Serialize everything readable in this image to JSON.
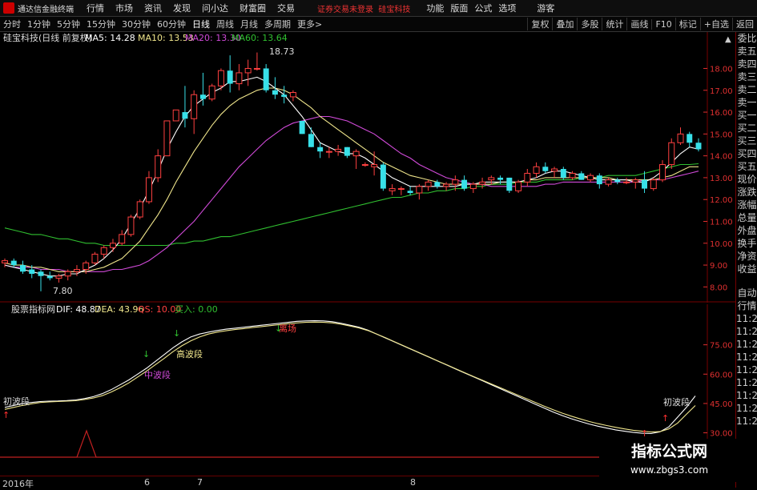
{
  "menubar": {
    "title": "通达信金融终端",
    "menus": [
      "行情",
      "市场",
      "资讯",
      "发现",
      "问小达",
      "财富圈",
      "交易"
    ],
    "notice": "证券交易未登录",
    "notice_stock": "硅宝科技",
    "right_menus": [
      "功能",
      "版面",
      "公式",
      "选项"
    ],
    "guest": "游客"
  },
  "periodbar": {
    "periods": [
      "分时",
      "1分钟",
      "5分钟",
      "15分钟",
      "30分钟",
      "60分钟",
      "日线",
      "周线",
      "月线",
      "多周期",
      "更多>"
    ],
    "active": "日线",
    "tools": [
      "复权",
      "叠加",
      "多股",
      "统计",
      "画线",
      "F10",
      "标记",
      "+自选",
      "返回"
    ]
  },
  "main_header": {
    "stock": "硅宝科技(日线 前复权)",
    "ma5": "MA5: 14.28",
    "ma10": "MA10: 13.53",
    "ma20": "MA20: 13.30",
    "ma60": "MA60: 13.64"
  },
  "ind_header": {
    "name": "股票指标网",
    "dif": "DIF: 48.87",
    "dea": "DEA: 43.96",
    "qs": "QS: 10.00",
    "buy": "买入: 0.00"
  },
  "annotations": {
    "high": "18.73",
    "low": "7.80",
    "initial_wave_left": "初波段",
    "mid_wave": "中波段",
    "high_wave": "高波段",
    "exit": "离场",
    "initial_wave_right": "初波段"
  },
  "time_axis": {
    "labels": [
      "2016年",
      "6",
      "7",
      "8"
    ]
  },
  "sidepanel": {
    "items": [
      "委比",
      "卖五",
      "卖四",
      "卖三",
      "卖二",
      "卖一",
      "买一",
      "买二",
      "买三",
      "买四",
      "买五",
      "现价",
      "涨跌",
      "涨幅",
      "总量",
      "外盘",
      "换手",
      "净资",
      "收益",
      "自动",
      "行情",
      "11:2",
      "11:2",
      "11:2",
      "11:2",
      "11:2",
      "11:2",
      "11:2",
      "11:2",
      "11:2"
    ]
  },
  "watermark": {
    "title": "指标公式网",
    "url": "www.zbgs3.com"
  },
  "colors": {
    "up": "#ff4040",
    "down": "#38e0e8",
    "ma5": "#ffffff",
    "ma10": "#f0e68c",
    "ma20": "#d04ad8",
    "ma60": "#30c030",
    "axis": "#e03030"
  },
  "chart_data": [
    {
      "type": "candlestick",
      "title": "硅宝科技(日线 前复权)",
      "ylim": [
        7.5,
        19.3
      ],
      "yticks": [
        8.0,
        9.0,
        10.0,
        11.0,
        12.0,
        13.0,
        14.0,
        15.0,
        16.0,
        17.0,
        18.0
      ],
      "candles": [
        [
          9.1,
          9.3,
          8.9,
          9.2
        ],
        [
          9.2,
          9.3,
          8.9,
          9.0
        ],
        [
          9.0,
          9.2,
          8.6,
          8.7
        ],
        [
          8.8,
          9.0,
          8.4,
          8.6
        ],
        [
          8.7,
          8.8,
          7.8,
          8.5
        ],
        [
          8.5,
          8.7,
          8.3,
          8.4
        ],
        [
          8.4,
          8.6,
          8.2,
          8.5
        ],
        [
          8.5,
          8.8,
          8.3,
          8.7
        ],
        [
          8.7,
          9.0,
          8.5,
          8.8
        ],
        [
          8.8,
          9.2,
          8.6,
          9.1
        ],
        [
          9.1,
          9.6,
          9.0,
          9.5
        ],
        [
          9.5,
          9.9,
          9.3,
          9.8
        ],
        [
          9.8,
          10.2,
          9.6,
          10.0
        ],
        [
          10.0,
          10.6,
          9.9,
          10.4
        ],
        [
          10.4,
          11.3,
          10.3,
          11.2
        ],
        [
          11.2,
          12.0,
          11.1,
          11.9
        ],
        [
          11.9,
          13.3,
          11.8,
          13.0
        ],
        [
          13.0,
          14.3,
          12.8,
          14.0
        ],
        [
          14.0,
          15.6,
          14.0,
          15.6
        ],
        [
          15.6,
          16.1,
          15.6,
          16.1
        ],
        [
          16.0,
          17.2,
          15.3,
          15.7
        ],
        [
          15.7,
          17.0,
          15.0,
          16.8
        ],
        [
          16.8,
          17.8,
          16.3,
          16.6
        ],
        [
          16.6,
          17.3,
          16.5,
          17.2
        ],
        [
          17.2,
          18.0,
          17.0,
          17.9
        ],
        [
          17.9,
          18.6,
          16.9,
          17.3
        ],
        [
          17.3,
          18.2,
          17.0,
          17.8
        ],
        [
          17.8,
          18.4,
          17.2,
          18.0
        ],
        [
          18.0,
          18.73,
          17.9,
          18.0
        ],
        [
          18.0,
          18.2,
          16.9,
          17.0
        ],
        [
          17.0,
          17.6,
          16.6,
          16.8
        ],
        [
          16.8,
          17.2,
          16.4,
          16.7
        ],
        [
          16.7,
          17.0,
          16.5,
          16.9
        ],
        [
          15.6,
          15.6,
          15.0,
          15.0
        ],
        [
          15.0,
          15.3,
          14.4,
          14.4
        ],
        [
          14.4,
          14.6,
          13.9,
          14.2
        ],
        [
          14.2,
          14.4,
          13.9,
          14.2
        ],
        [
          14.2,
          14.5,
          14.0,
          14.3
        ],
        [
          14.4,
          14.4,
          13.9,
          14.0
        ],
        [
          14.0,
          14.3,
          13.4,
          14.2
        ],
        [
          13.6,
          13.7,
          13.5,
          13.6
        ],
        [
          13.5,
          14.2,
          13.1,
          13.6
        ],
        [
          13.6,
          13.7,
          12.4,
          12.5
        ],
        [
          12.4,
          12.7,
          12.2,
          12.5
        ],
        [
          12.5,
          12.6,
          12.2,
          12.5
        ],
        [
          12.4,
          12.6,
          12.2,
          12.3
        ],
        [
          12.3,
          12.7,
          12.0,
          12.6
        ],
        [
          12.6,
          12.9,
          12.4,
          12.8
        ],
        [
          12.8,
          12.9,
          12.5,
          12.6
        ],
        [
          12.6,
          12.8,
          12.4,
          12.7
        ],
        [
          12.7,
          13.1,
          12.4,
          12.9
        ],
        [
          12.9,
          13.1,
          12.4,
          12.5
        ],
        [
          12.5,
          12.8,
          12.3,
          12.7
        ],
        [
          12.7,
          13.0,
          12.5,
          12.8
        ],
        [
          12.9,
          13.1,
          12.7,
          13.0
        ],
        [
          13.0,
          13.1,
          12.7,
          12.9
        ],
        [
          13.0,
          13.0,
          12.3,
          12.4
        ],
        [
          12.4,
          12.9,
          12.3,
          12.8
        ],
        [
          12.8,
          13.4,
          12.6,
          13.2
        ],
        [
          13.2,
          13.7,
          13.0,
          13.5
        ],
        [
          13.5,
          13.7,
          13.2,
          13.3
        ],
        [
          13.3,
          13.5,
          13.0,
          13.4
        ],
        [
          13.4,
          13.5,
          12.9,
          13.0
        ],
        [
          13.0,
          13.3,
          12.9,
          13.2
        ],
        [
          13.2,
          13.3,
          12.9,
          12.9
        ],
        [
          12.9,
          13.2,
          12.8,
          13.1
        ],
        [
          13.1,
          13.2,
          12.5,
          12.7
        ],
        [
          12.7,
          13.0,
          12.6,
          12.9
        ],
        [
          12.9,
          13.0,
          12.7,
          12.8
        ],
        [
          12.8,
          13.0,
          12.7,
          12.8
        ],
        [
          12.8,
          13.0,
          12.5,
          12.9
        ],
        [
          12.9,
          13.3,
          12.3,
          12.5
        ],
        [
          12.5,
          13.0,
          12.4,
          12.9
        ],
        [
          12.9,
          13.8,
          12.8,
          13.6
        ],
        [
          13.6,
          14.8,
          13.4,
          14.6
        ],
        [
          14.6,
          15.3,
          14.5,
          15.0
        ],
        [
          15.0,
          15.1,
          14.4,
          14.6
        ],
        [
          14.6,
          14.8,
          14.2,
          14.3
        ]
      ],
      "ma5": [
        9.0,
        8.9,
        8.8,
        8.7,
        8.6,
        8.5,
        8.5,
        8.6,
        8.6,
        8.8,
        9.0,
        9.3,
        9.7,
        10.2,
        10.9,
        11.6,
        12.4,
        13.3,
        14.3,
        15.1,
        15.8,
        16.3,
        16.6,
        16.9,
        17.1,
        17.4,
        17.4,
        17.5,
        17.6,
        17.4,
        17.1,
        16.8,
        16.3,
        15.8,
        15.2,
        14.6,
        14.4,
        14.2,
        14.1,
        14.1,
        13.9,
        13.6,
        13.3,
        13.0,
        12.8,
        12.6,
        12.6,
        12.6,
        12.6,
        12.6,
        12.6,
        12.7,
        12.7,
        12.8,
        12.8,
        12.8,
        12.8,
        12.8,
        12.9,
        13.0,
        13.2,
        13.3,
        13.3,
        13.2,
        13.1,
        13.0,
        12.9,
        12.9,
        12.9,
        12.9,
        12.8,
        12.8,
        13.0,
        13.3,
        13.7,
        14.1,
        14.4,
        14.3
      ],
      "ma10": [
        9.1,
        9.0,
        9.0,
        8.9,
        8.9,
        8.8,
        8.7,
        8.7,
        8.7,
        8.7,
        8.8,
        8.9,
        9.1,
        9.3,
        9.7,
        10.1,
        10.7,
        11.3,
        12.0,
        12.8,
        13.5,
        14.2,
        14.8,
        15.4,
        15.9,
        16.3,
        16.6,
        16.8,
        17.0,
        17.1,
        17.1,
        17.0,
        16.8,
        16.5,
        16.2,
        15.8,
        15.5,
        15.2,
        14.9,
        14.6,
        14.3,
        14.0,
        13.7,
        13.5,
        13.3,
        13.1,
        13.0,
        12.9,
        12.8,
        12.7,
        12.7,
        12.7,
        12.7,
        12.7,
        12.7,
        12.8,
        12.8,
        12.8,
        12.9,
        12.9,
        13.0,
        13.0,
        13.0,
        13.0,
        13.0,
        13.0,
        13.0,
        13.0,
        12.9,
        12.9,
        12.9,
        12.9,
        12.9,
        13.0,
        13.1,
        13.3,
        13.5,
        13.5
      ],
      "ma20": [
        9.0,
        8.9,
        8.9,
        8.9,
        8.8,
        8.8,
        8.8,
        8.7,
        8.7,
        8.7,
        8.7,
        8.7,
        8.8,
        8.8,
        8.9,
        9.0,
        9.2,
        9.5,
        9.8,
        10.2,
        10.6,
        11.0,
        11.5,
        12.0,
        12.5,
        13.0,
        13.5,
        13.9,
        14.3,
        14.7,
        15.0,
        15.3,
        15.5,
        15.6,
        15.7,
        15.8,
        15.8,
        15.7,
        15.6,
        15.4,
        15.2,
        15.0,
        14.7,
        14.4,
        14.1,
        13.9,
        13.6,
        13.4,
        13.2,
        13.0,
        12.9,
        12.8,
        12.7,
        12.7,
        12.6,
        12.6,
        12.6,
        12.6,
        12.6,
        12.6,
        12.7,
        12.7,
        12.8,
        12.8,
        12.8,
        12.8,
        12.8,
        12.8,
        12.8,
        12.8,
        12.8,
        12.9,
        12.9,
        12.9,
        13.0,
        13.1,
        13.2,
        13.3
      ],
      "ma60": [
        10.7,
        10.6,
        10.5,
        10.4,
        10.4,
        10.3,
        10.2,
        10.2,
        10.1,
        10.0,
        10.0,
        9.9,
        9.9,
        9.9,
        9.9,
        9.9,
        9.9,
        9.9,
        9.9,
        10.0,
        10.0,
        10.1,
        10.1,
        10.2,
        10.3,
        10.3,
        10.4,
        10.5,
        10.6,
        10.7,
        10.8,
        10.9,
        11.0,
        11.1,
        11.2,
        11.3,
        11.4,
        11.5,
        11.6,
        11.7,
        11.8,
        11.9,
        12.0,
        12.1,
        12.1,
        12.2,
        12.3,
        12.3,
        12.4,
        12.4,
        12.5,
        12.5,
        12.6,
        12.6,
        12.7,
        12.7,
        12.7,
        12.8,
        12.8,
        12.8,
        12.9,
        12.9,
        12.9,
        12.9,
        13.0,
        13.0,
        13.0,
        13.1,
        13.1,
        13.1,
        13.1,
        13.2,
        13.3,
        13.4,
        13.5,
        13.6,
        13.6,
        13.64
      ]
    },
    {
      "type": "line",
      "title": "股票指标网",
      "ylim": [
        20,
        90
      ],
      "yticks": [
        30.0,
        45.0,
        60.0,
        75.0
      ],
      "series": [
        {
          "name": "DIF",
          "values": [
            43,
            44,
            45,
            45.5,
            46,
            46.2,
            46.3,
            46.5,
            46.8,
            47.5,
            48.5,
            50,
            52,
            54.5,
            57,
            60,
            63,
            66.5,
            70,
            73.5,
            76.5,
            79,
            80.5,
            81.5,
            82.3,
            83,
            83.5,
            84,
            84.5,
            85,
            85.5,
            86,
            86.5,
            87,
            87.2,
            87.3,
            87.2,
            86.8,
            86,
            85,
            84,
            82.5,
            80.5,
            78.5,
            76.5,
            74.5,
            72.5,
            70.5,
            68.5,
            66.5,
            64.5,
            62.5,
            60.5,
            58.5,
            56.5,
            54.5,
            52.5,
            50.5,
            48.5,
            46.5,
            44.5,
            42.5,
            40.5,
            38.8,
            37.2,
            35.8,
            34.5,
            33.4,
            32.4,
            31.5,
            30.8,
            30.2,
            29.8,
            29.6,
            30.5,
            33,
            38,
            43,
            48.87
          ]
        },
        {
          "name": "DEA",
          "values": [
            42,
            43,
            44,
            44.8,
            45.5,
            45.8,
            46,
            46.2,
            46.4,
            47,
            47.8,
            49,
            50.8,
            53,
            55.5,
            58.5,
            61.5,
            64.8,
            68,
            71.5,
            74.5,
            77,
            79,
            80.5,
            81.5,
            82.2,
            82.8,
            83.3,
            83.8,
            84.3,
            84.8,
            85.3,
            85.8,
            86.2,
            86.5,
            86.6,
            86.5,
            86.2,
            85.5,
            84.6,
            83.6,
            82.3,
            80.5,
            78.6,
            76.6,
            74.6,
            72.6,
            70.6,
            68.6,
            66.6,
            64.6,
            62.6,
            60.6,
            58.7,
            56.8,
            54.9,
            53,
            51.1,
            49.2,
            47.3,
            45.4,
            43.5,
            41.7,
            40,
            38.5,
            37.1,
            35.8,
            34.7,
            33.7,
            32.8,
            32,
            31.3,
            30.8,
            30.4,
            30.6,
            32,
            35,
            39.5,
            43.96
          ]
        }
      ]
    }
  ]
}
